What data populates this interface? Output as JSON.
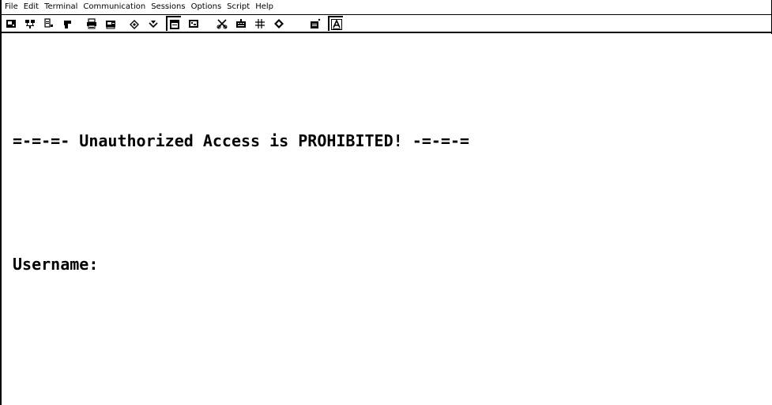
{
  "menu": {
    "items": [
      {
        "label": "File"
      },
      {
        "label": "Edit"
      },
      {
        "label": "Terminal"
      },
      {
        "label": "Communication"
      },
      {
        "label": "Sessions"
      },
      {
        "label": "Options"
      },
      {
        "label": "Script"
      },
      {
        "label": "Help"
      }
    ]
  },
  "toolbar": {
    "buttons": [
      {
        "icon": "new-session-icon"
      },
      {
        "icon": "connect-icon"
      },
      {
        "icon": "properties-icon"
      },
      {
        "icon": "paste-icon"
      },
      {
        "icon": "print-icon"
      },
      {
        "icon": "print-screen-icon"
      },
      {
        "icon": "send-file-icon"
      },
      {
        "icon": "receive-file-icon"
      },
      {
        "icon": "terminal-window-icon"
      },
      {
        "icon": "screen-icon"
      },
      {
        "icon": "tools-icon"
      },
      {
        "icon": "keyboard-icon"
      },
      {
        "icon": "grid-icon"
      },
      {
        "icon": "script-icon"
      },
      {
        "icon": "capture-icon"
      },
      {
        "icon": "font-icon"
      }
    ]
  },
  "terminal": {
    "banner": "=-=-=- Unauthorized Access is PROHIBITED! -=-=-=",
    "prompt": "Username:"
  }
}
